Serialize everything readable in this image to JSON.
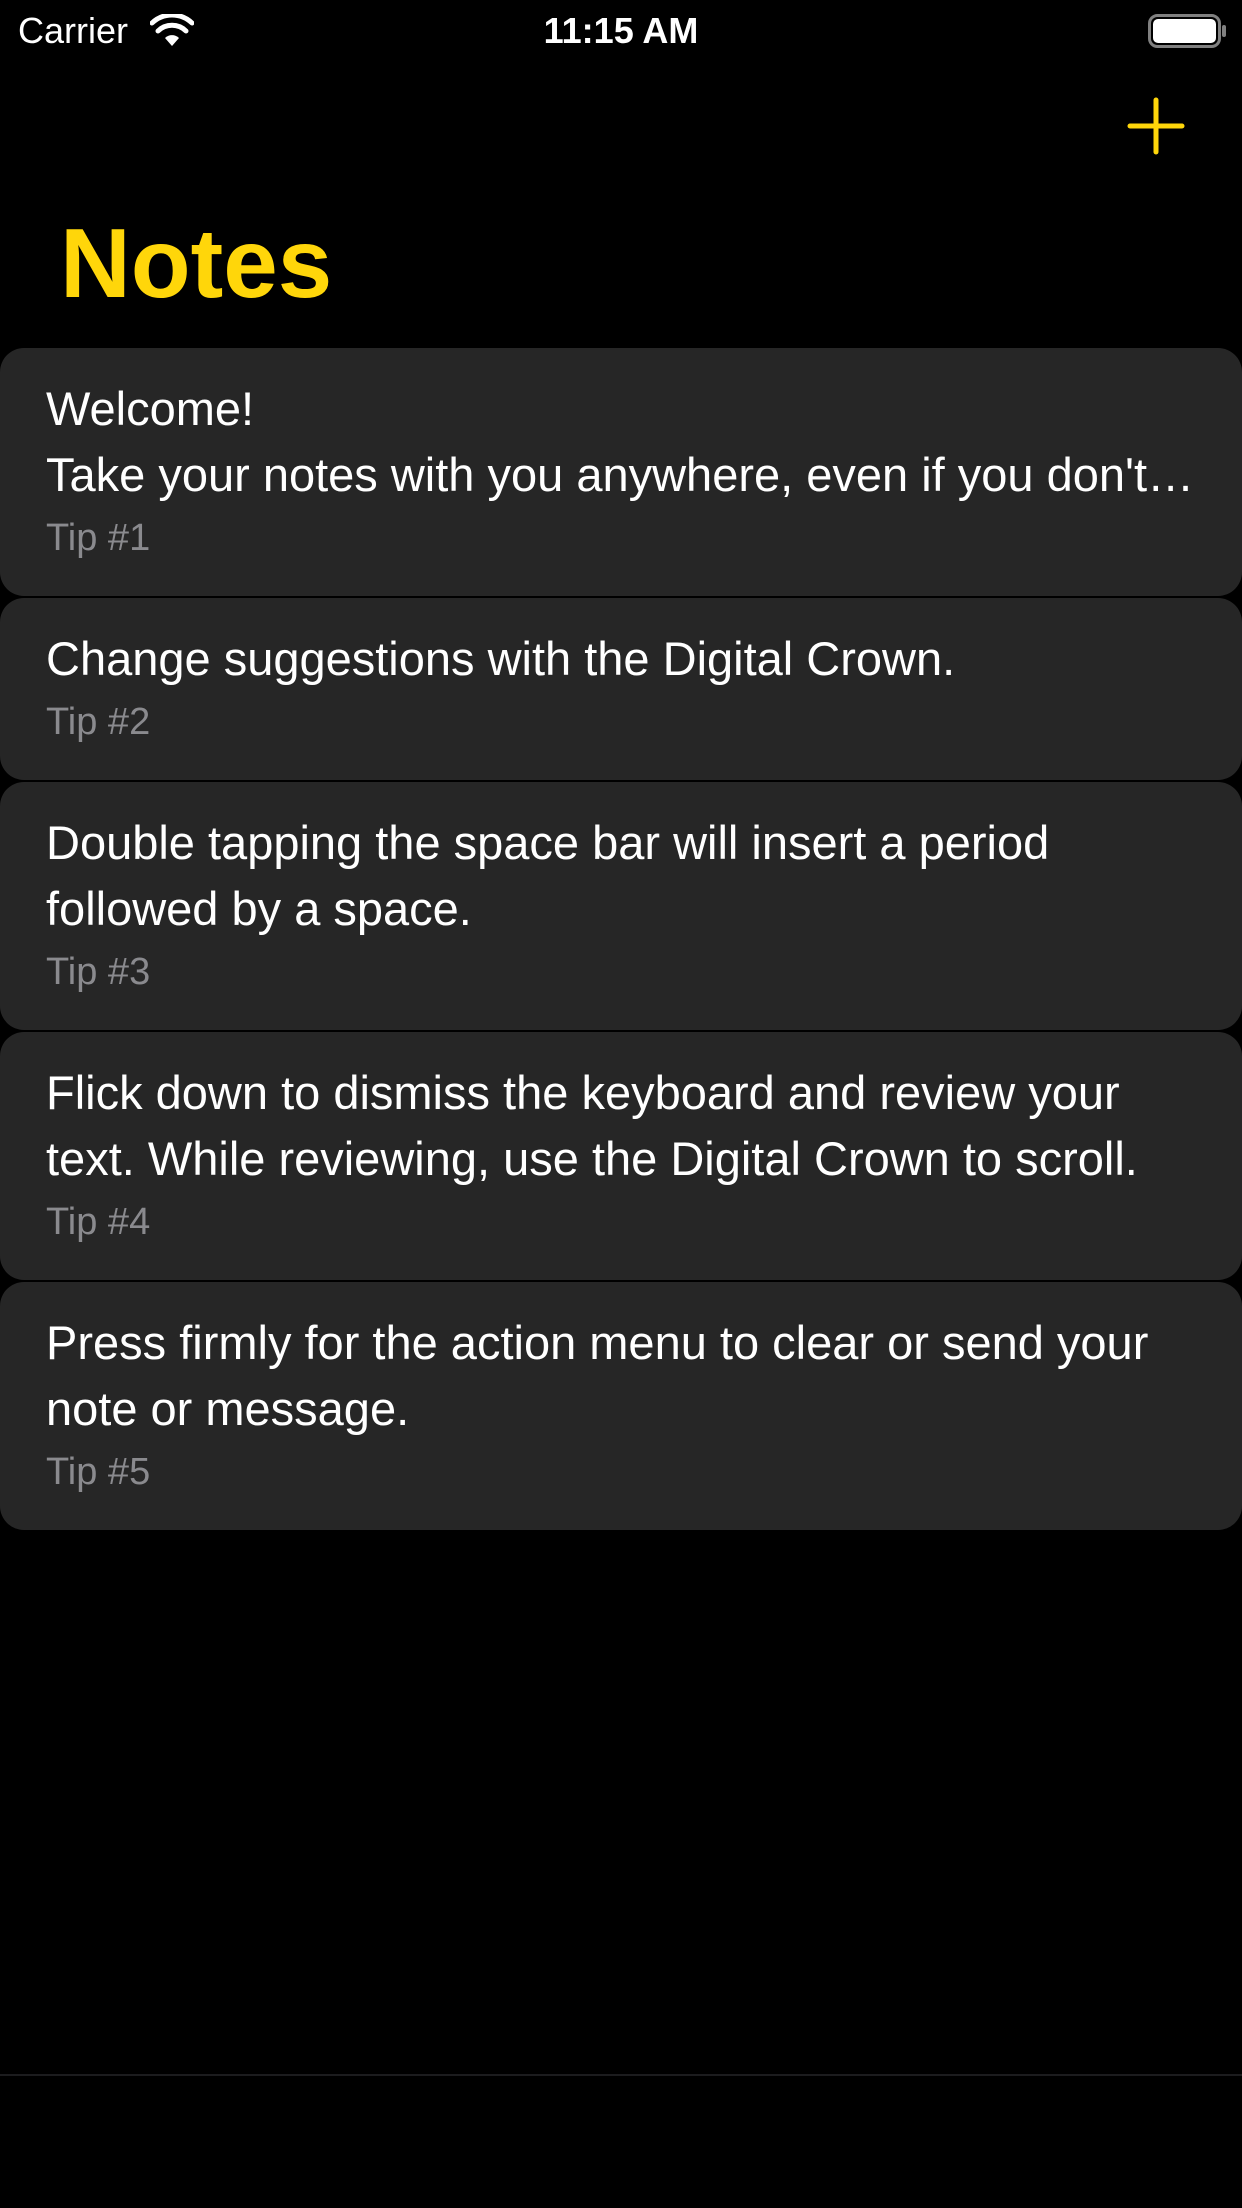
{
  "status_bar": {
    "carrier": "Carrier",
    "time": "11:15 AM"
  },
  "nav": {
    "title": "Notes",
    "add_icon": "plus-icon"
  },
  "colors": {
    "accent": "#ffd60a",
    "background": "#000000",
    "card": "#262626",
    "secondary_text": "#8a8a8e"
  },
  "notes": [
    {
      "text": "Welcome!\nTake your notes with you anywhere, even if you don't have your phone.",
      "tip": "Tip #1"
    },
    {
      "text": "Change suggestions with the Digital Crown.",
      "tip": "Tip #2"
    },
    {
      "text": "Double tapping the space bar will insert a period followed by a space.",
      "tip": "Tip #3"
    },
    {
      "text": "Flick down to dismiss the keyboard and review your text. While reviewing, use the Digital Crown to scroll.",
      "tip": "Tip #4"
    },
    {
      "text": "Press firmly for the action menu to clear or send your note or message.",
      "tip": "Tip #5"
    }
  ]
}
